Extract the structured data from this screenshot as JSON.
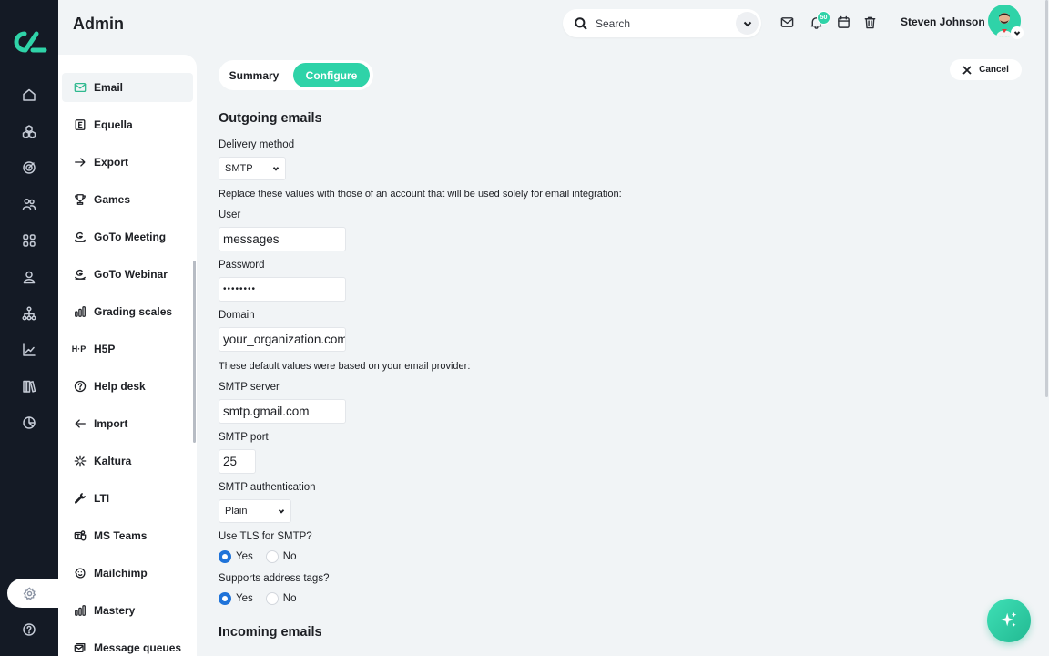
{
  "app": {
    "page_title": "Admin"
  },
  "header": {
    "search_label": "Search",
    "notification_count": "50",
    "user_name": "Steven Johnson"
  },
  "rail": {
    "icons": [
      "home-icon",
      "cubes-icon",
      "target-icon",
      "people-icon",
      "apps-grid-icon",
      "user-icon",
      "hierarchy-icon",
      "chart-line-icon",
      "library-icon",
      "pie-chart-icon",
      "settings-icon",
      "help-icon"
    ]
  },
  "sidebar": {
    "items": [
      {
        "label": "Email",
        "icon": "mail-icon",
        "active": true
      },
      {
        "label": "Equella",
        "icon": "equella-icon"
      },
      {
        "label": "Export",
        "icon": "arrow-right-icon"
      },
      {
        "label": "Games",
        "icon": "trophy-icon"
      },
      {
        "label": "GoTo Meeting",
        "icon": "goto-icon"
      },
      {
        "label": "GoTo Webinar",
        "icon": "goto-icon"
      },
      {
        "label": "Grading scales",
        "icon": "bars-icon"
      },
      {
        "label": "H5P",
        "icon": "h5p-icon"
      },
      {
        "label": "Help desk",
        "icon": "question-icon"
      },
      {
        "label": "Import",
        "icon": "arrow-left-icon"
      },
      {
        "label": "Kaltura",
        "icon": "kaltura-icon"
      },
      {
        "label": "LTI",
        "icon": "wrench-icon"
      },
      {
        "label": "MS Teams",
        "icon": "teams-icon"
      },
      {
        "label": "Mailchimp",
        "icon": "mailchimp-icon"
      },
      {
        "label": "Mastery",
        "icon": "bars-icon"
      },
      {
        "label": "Message queues",
        "icon": "queue-icon"
      }
    ]
  },
  "tabs": {
    "summary": "Summary",
    "configure": "Configure",
    "active": "Configure"
  },
  "cancel_label": "Cancel",
  "form": {
    "outgoing_title": "Outgoing emails",
    "delivery_method_label": "Delivery method",
    "delivery_method_value": "SMTP",
    "account_note": "Replace these values with those of an account that will be used solely for email integration:",
    "user_label": "User",
    "user_value": "messages",
    "password_label": "Password",
    "password_value": "••••••••",
    "domain_label": "Domain",
    "domain_value": "your_organization.com",
    "provider_note": "These default values were based on your email provider:",
    "smtp_server_label": "SMTP server",
    "smtp_server_value": "smtp.gmail.com",
    "smtp_port_label": "SMTP port",
    "smtp_port_value": "25",
    "smtp_auth_label": "SMTP authentication",
    "smtp_auth_value": "Plain",
    "tls_label": "Use TLS for SMTP?",
    "tls_yes": "Yes",
    "tls_no": "No",
    "tls_selected": "Yes",
    "tags_label": "Supports address tags?",
    "tags_yes": "Yes",
    "tags_no": "No",
    "tags_selected": "Yes",
    "incoming_title": "Incoming emails"
  },
  "colors": {
    "accent": "#2fd3a8",
    "rail": "#141a25",
    "radio": "#1f73d9",
    "background": "#f1f4f6"
  }
}
